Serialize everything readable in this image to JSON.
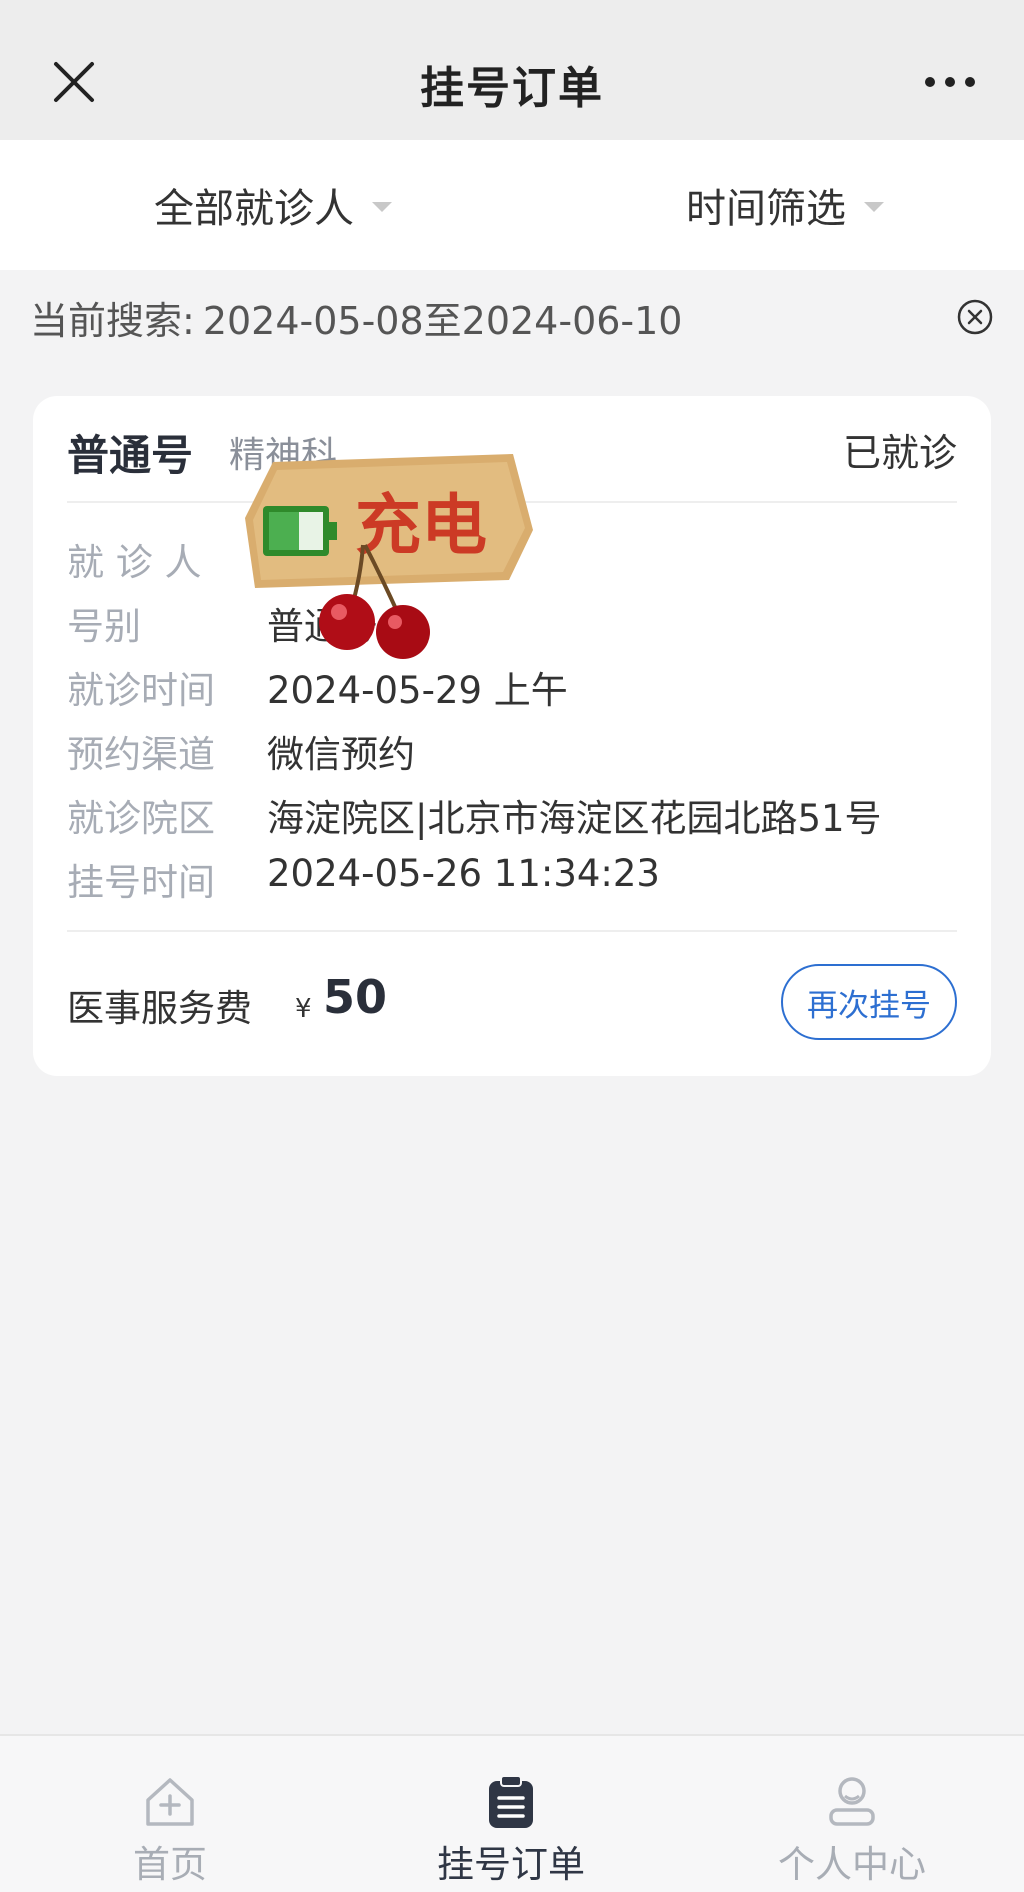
{
  "header": {
    "title": "挂号订单"
  },
  "filters": {
    "patient_label": "全部就诊人",
    "time_label": "时间筛选"
  },
  "search": {
    "label": "当前搜索:",
    "range": "2024-05-08至2024-06-10"
  },
  "order": {
    "reg_type": "普通号",
    "department": "精神科",
    "status": "已就诊",
    "rows": [
      {
        "key": "就 诊 人",
        "value": ""
      },
      {
        "key": "号别",
        "value": "普通号"
      },
      {
        "key": "就诊时间",
        "value": "2024-05-29 上午"
      },
      {
        "key": "预约渠道",
        "value": "微信预约"
      },
      {
        "key": "就诊院区",
        "value": "海淀院区|北京市海淀区花园北路51号"
      },
      {
        "key": "挂号时间",
        "value": "2024-05-26 11:34:23"
      }
    ],
    "fee_label": "医事服务费",
    "fee_currency": "¥",
    "fee_amount": "50",
    "rebook_label": "再次挂号"
  },
  "sticker": {
    "text": "充电"
  },
  "bottom_nav": {
    "items": [
      {
        "label": "首页",
        "icon": "home-plus-icon"
      },
      {
        "label": "挂号订单",
        "icon": "clipboard-icon",
        "active": true
      },
      {
        "label": "个人中心",
        "icon": "user-icon"
      }
    ]
  },
  "colors": {
    "accent": "#2d6fd1",
    "background": "#f3f3f4",
    "label_gray": "#a7acb5"
  }
}
